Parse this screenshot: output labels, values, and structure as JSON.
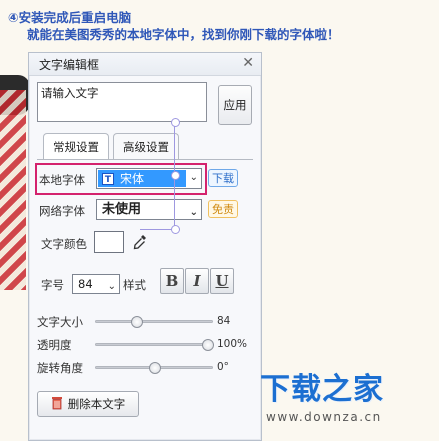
{
  "instructions": {
    "heading": "④安装完成后重启电脑",
    "subheading": "就能在美图秀秀的本地字体中，找到你刚下载的字体啦！"
  },
  "dialog": {
    "title": "文字编辑框",
    "close_icon": "close-icon",
    "text_input_value": "请输入文字",
    "apply_label": "应用",
    "tabs": [
      {
        "label": "常规设置",
        "active": true
      },
      {
        "label": "高级设置",
        "active": false
      }
    ],
    "local_font": {
      "label": "本地字体",
      "value": "宋体",
      "badge": "下载"
    },
    "web_font": {
      "label": "网络字体",
      "value": "未使用",
      "badge": "免责"
    },
    "text_color": {
      "label": "文字颜色",
      "value": "#ffffff"
    },
    "font_size": {
      "label": "字号",
      "value": "84",
      "style_label": "样式"
    },
    "style_buttons": {
      "bold": "B",
      "italic": "I",
      "underline": "U"
    },
    "sliders": [
      {
        "label": "文字大小",
        "value": "84",
        "level": 0.33
      },
      {
        "label": "透明度",
        "value": "100%",
        "level": 1.0
      },
      {
        "label": "旋转角度",
        "value": "0°",
        "level": 0.5
      }
    ],
    "delete_label": "删除本文字"
  },
  "watermark": {
    "logo": "下载之家",
    "url": "www.downza.cn"
  },
  "colors": {
    "heading": "#2f57b8",
    "highlight": "#d4226d",
    "selection": "#3399ff",
    "watermark": "#1c6fd1"
  }
}
